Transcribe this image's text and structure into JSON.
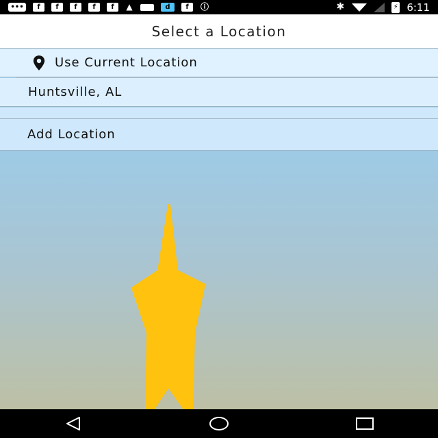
{
  "status_bar": {
    "time": "6:11",
    "left_icons": [
      "message-icon",
      "facebook-icon",
      "facebook-icon",
      "facebook-icon",
      "facebook-icon",
      "facebook-icon",
      "notification-icon",
      "mail-icon",
      "download-icon",
      "facebook-icon",
      "alert-icon"
    ],
    "right_icons": [
      "bluetooth-icon",
      "wifi-icon",
      "signal-icon",
      "battery-icon"
    ]
  },
  "header": {
    "title": "Select a Location"
  },
  "locations": {
    "current_label": "Use Current Location",
    "items": [
      {
        "label": "Huntsville, AL"
      }
    ],
    "add_label": "Add Location"
  },
  "colors": {
    "accent_yellow": "#ffc20e",
    "sky_top": "#a7d8f7",
    "sky_bottom": "#c1bf9c"
  },
  "nav_bar": {
    "buttons": [
      "back-icon",
      "home-icon",
      "recents-icon"
    ]
  }
}
